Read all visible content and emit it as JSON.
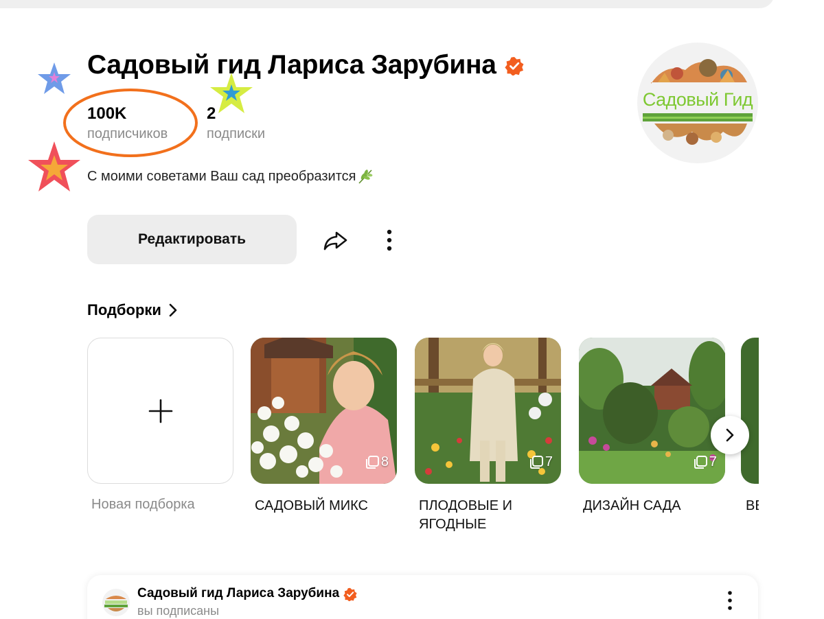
{
  "profile": {
    "name": "Садовый гид Лариса Зарубина",
    "followers_count": "100K",
    "followers_label": "подписчиков",
    "following_count": "2",
    "following_label": "подписки",
    "bio": "С моими советами Ваш сад преобразится",
    "avatar_text": "Садовый Гид",
    "edit_label": "Редактировать"
  },
  "collections": {
    "title": "Подборки",
    "new_label": "Новая подборка",
    "items": [
      {
        "label": "САДОВЫЙ МИКС",
        "count": "8"
      },
      {
        "label": "ПЛОДОВЫЕ И ЯГОДНЫЕ",
        "count": "7"
      },
      {
        "label": "ДИЗАЙН САДА",
        "count": "7"
      },
      {
        "label": "ВБ"
      }
    ]
  },
  "post": {
    "author": "Садовый гид Лариса Зарубина",
    "status": "вы подписаны"
  },
  "colors": {
    "verified": "#f25e1f",
    "annotation_circle": "#f2701c",
    "button_bg": "#ededed",
    "muted_text": "#8a8a8a"
  },
  "icons": [
    "verified-icon",
    "leaf-icon",
    "share-icon",
    "more-icon",
    "chevron-right-icon",
    "plus-icon",
    "stack-icon"
  ]
}
